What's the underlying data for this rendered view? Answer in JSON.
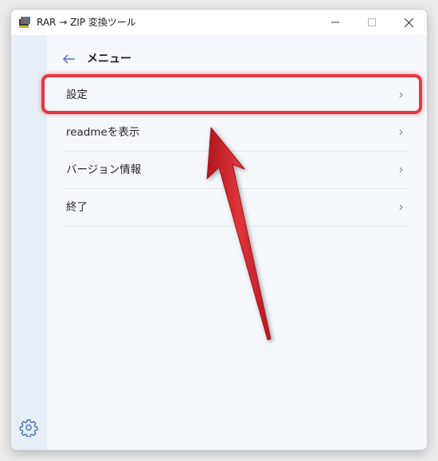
{
  "window": {
    "title": "RAR → ZIP 変換ツール"
  },
  "page": {
    "title": "メニュー"
  },
  "menu": {
    "items": [
      {
        "label": "設定"
      },
      {
        "label": "readmeを表示"
      },
      {
        "label": "バージョン情報"
      },
      {
        "label": "終了"
      }
    ]
  },
  "icons": {
    "app": "archive-app-icon",
    "minimize": "minimize-icon",
    "maximize": "maximize-icon",
    "close": "close-icon",
    "back": "back-arrow-icon",
    "chevron": "chevron-right-icon",
    "settings": "gear-icon"
  },
  "colors": {
    "accent": "#4a6fb5",
    "highlight": "#e5383f",
    "background": "#f4f7fc",
    "sidebar": "#e8eef8"
  }
}
